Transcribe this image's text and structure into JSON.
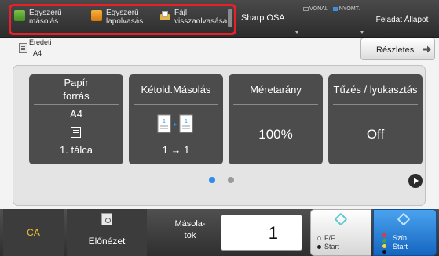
{
  "top_bar": {
    "shortcuts": [
      {
        "line1": "Egyszerű",
        "line2": "másolás",
        "icon": "copy-icon",
        "color": "#5aa832"
      },
      {
        "line1": "Egyszerű",
        "line2": "lapolvasás",
        "icon": "scan-icon",
        "color": "#f0a030"
      },
      {
        "line1": "Fájl",
        "line2": "visszaolvasása",
        "icon": "file-retrieve-icon",
        "color": "#e8b542"
      }
    ],
    "device_name": "Sharp OSA",
    "line_status": {
      "line": "VONAL",
      "print": "NYOMT."
    },
    "job_status": "Feladat Állapot"
  },
  "original": {
    "label": "Eredeti",
    "size": "A4"
  },
  "details_button": "Részletes",
  "tiles": {
    "paper": {
      "title_line1": "Papír",
      "title_line2": "forrás",
      "size": "A4",
      "tray": "1. tálca"
    },
    "duplex": {
      "title": "Kétold.Másolás",
      "value": "1 → 1"
    },
    "ratio": {
      "title": "Méretarány",
      "value": "100%"
    },
    "staple": {
      "title": "Tűzés / lyukasztás",
      "value": "Off"
    }
  },
  "pagination": {
    "current": 1,
    "total": 2
  },
  "bottom_bar": {
    "ca": "CA",
    "preview": "Előnézet",
    "copies_label_line1": "Másola-",
    "copies_label_line2": "tok",
    "copies_value": "1",
    "bw_start": {
      "line1": "F/F",
      "line2": "Start"
    },
    "color_start": {
      "line1": "Szín",
      "line2": "Start"
    }
  },
  "colors": {
    "highlight_frame": "#e8202a",
    "accent_blue": "#2d8cf0",
    "ca_text": "#f1c232"
  }
}
